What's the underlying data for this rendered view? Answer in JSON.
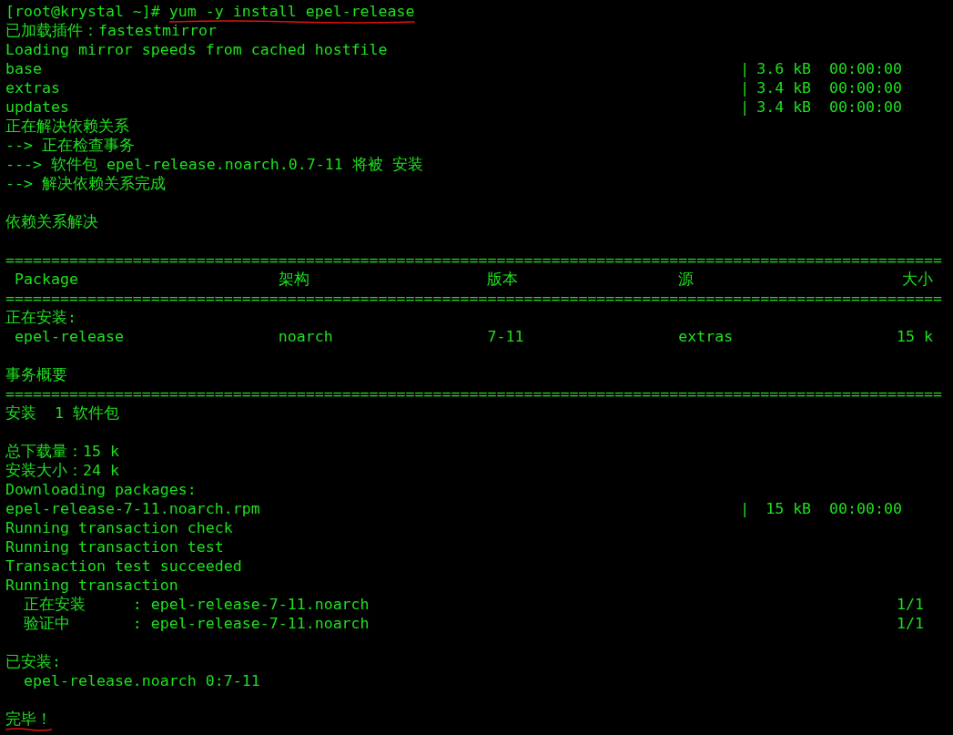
{
  "lines": [
    {
      "kind": "prompt",
      "prompt": "[root@krystal ~]#",
      "command": "yum -y install epel-release",
      "underlined": true
    },
    {
      "kind": "text",
      "text": "已加载插件：fastestmirror"
    },
    {
      "kind": "text",
      "text": "Loading mirror speeds from cached hostfile"
    },
    {
      "kind": "repo",
      "name": "base",
      "sep": "|",
      "size": "3.6 kB",
      "time": "00:00:00"
    },
    {
      "kind": "repo",
      "name": "extras",
      "sep": "|",
      "size": "3.4 kB",
      "time": "00:00:00"
    },
    {
      "kind": "repo",
      "name": "updates",
      "sep": "|",
      "size": "3.4 kB",
      "time": "00:00:00"
    },
    {
      "kind": "text",
      "text": "正在解决依赖关系"
    },
    {
      "kind": "text",
      "text": "--> 正在检查事务"
    },
    {
      "kind": "text",
      "text": "---> 软件包 epel-release.noarch.0.7-11 将被 安装"
    },
    {
      "kind": "text",
      "text": "--> 解决依赖关系完成"
    },
    {
      "kind": "blank"
    },
    {
      "kind": "text",
      "text": "依赖关系解决"
    },
    {
      "kind": "blank"
    },
    {
      "kind": "rule",
      "text": "======================================================================================================="
    },
    {
      "kind": "table",
      "cells": [
        "Package",
        "架构",
        "版本",
        "源",
        "大小"
      ]
    },
    {
      "kind": "rule",
      "text": "======================================================================================================="
    },
    {
      "kind": "text",
      "text": "正在安装:"
    },
    {
      "kind": "table",
      "cells": [
        "epel-release",
        "noarch",
        "7-11",
        "extras",
        "15 k"
      ]
    },
    {
      "kind": "blank"
    },
    {
      "kind": "text",
      "text": "事务概要"
    },
    {
      "kind": "rule",
      "text": "======================================================================================================="
    },
    {
      "kind": "text",
      "text": "安装  1 软件包"
    },
    {
      "kind": "blank"
    },
    {
      "kind": "text",
      "text": "总下载量：15 k"
    },
    {
      "kind": "text",
      "text": "安装大小：24 k"
    },
    {
      "kind": "text",
      "text": "Downloading packages:"
    },
    {
      "kind": "repo",
      "name": "epel-release-7-11.noarch.rpm",
      "sep": "|",
      "size": " 15 kB",
      "time": "00:00:00"
    },
    {
      "kind": "text",
      "text": "Running transaction check"
    },
    {
      "kind": "text",
      "text": "Running transaction test"
    },
    {
      "kind": "text",
      "text": "Transaction test succeeded"
    },
    {
      "kind": "text",
      "text": "Running transaction"
    },
    {
      "kind": "progress",
      "label": "正在安装",
      "detail": ": epel-release-7-11.noarch",
      "step": "1/1"
    },
    {
      "kind": "progress",
      "label": "验证中",
      "detail": ": epel-release-7-11.noarch",
      "step": "1/1"
    },
    {
      "kind": "blank"
    },
    {
      "kind": "text",
      "text": "已安装:"
    },
    {
      "kind": "text",
      "text": "  epel-release.noarch 0:7-11"
    },
    {
      "kind": "blank"
    },
    {
      "kind": "text",
      "text": "完毕！",
      "underlined": true
    }
  ]
}
